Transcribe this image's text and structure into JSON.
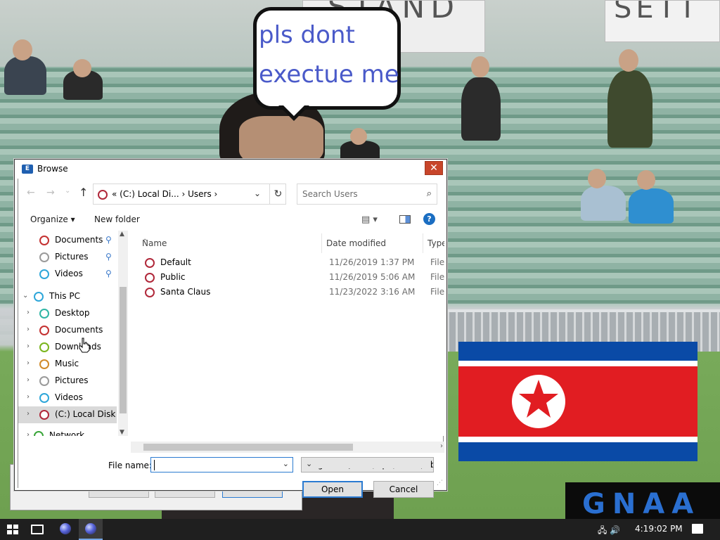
{
  "wallpaper": {
    "sign_left": "STAND",
    "sign_right": "SETT",
    "bubble_line1": "pls dont",
    "bubble_line2": "exectue me",
    "logo": "GNAA",
    "flag_colors": {
      "blue": "#0a4aa6",
      "red": "#e11d22",
      "white": "#ffffff"
    }
  },
  "dialog": {
    "title": "Browse",
    "close_label": "✕",
    "nav": {
      "back_icon": "←",
      "forward_icon": "→",
      "recent_icon": "⌄",
      "up_icon": "↑",
      "address": "«  (C:) Local Di...  ›  Users  ›",
      "address_dropdown": "⌄",
      "refresh_icon": "↻",
      "search_placeholder": "Search Users",
      "search_icon": "⌕"
    },
    "toolbar": {
      "organize": "Organize ▾",
      "new_folder": "New folder",
      "view_icon": "▤ ▾",
      "help": "?"
    },
    "nav_pane": {
      "items": [
        {
          "label": "Documents",
          "pinned": true,
          "icon_color": "#c43131"
        },
        {
          "label": "Pictures",
          "pinned": true,
          "icon_color": "#9a9a9a"
        },
        {
          "label": "Videos",
          "pinned": true,
          "icon_color": "#2ea6d9"
        },
        {
          "label": "This PC",
          "expanded": true,
          "icon_color": "#2ea6d9"
        },
        {
          "label": "Desktop",
          "icon_color": "#2fb5a5"
        },
        {
          "label": "Documents",
          "icon_color": "#c43131"
        },
        {
          "label": "Downloads",
          "icon_color": "#7ab51d"
        },
        {
          "label": "Music",
          "icon_color": "#d08a2a"
        },
        {
          "label": "Pictures",
          "icon_color": "#9a9a9a"
        },
        {
          "label": "Videos",
          "icon_color": "#2ea6d9"
        },
        {
          "label": "(C:) Local Disk",
          "selected": true,
          "icon_color": "#b0283a"
        },
        {
          "label": "Network",
          "icon_color": "#3aa53a"
        }
      ],
      "pin_icon": "📌",
      "chevron_right": "›",
      "chevron_down": "⌄"
    },
    "file_list": {
      "columns": [
        "Name",
        "Date modified",
        "Type"
      ],
      "rows": [
        {
          "name": "Default",
          "date": "11/26/2019 1:37 PM",
          "type": "File fo"
        },
        {
          "name": "Public",
          "date": "11/26/2019 5:06 AM",
          "type": "File fo"
        },
        {
          "name": "Santa Claus",
          "date": "11/23/2022 3:16 AM",
          "type": "File fo"
        }
      ]
    },
    "bottom": {
      "file_name_label": "File name:",
      "file_name_value": "",
      "file_type": "Programs (*.exe;*.pif;*.com;*.bat)",
      "open_label": "Open",
      "cancel_label": "Cancel"
    }
  },
  "taskbar": {
    "time": "4:19:02 PM",
    "tray_icons": "🖧  🔊"
  }
}
